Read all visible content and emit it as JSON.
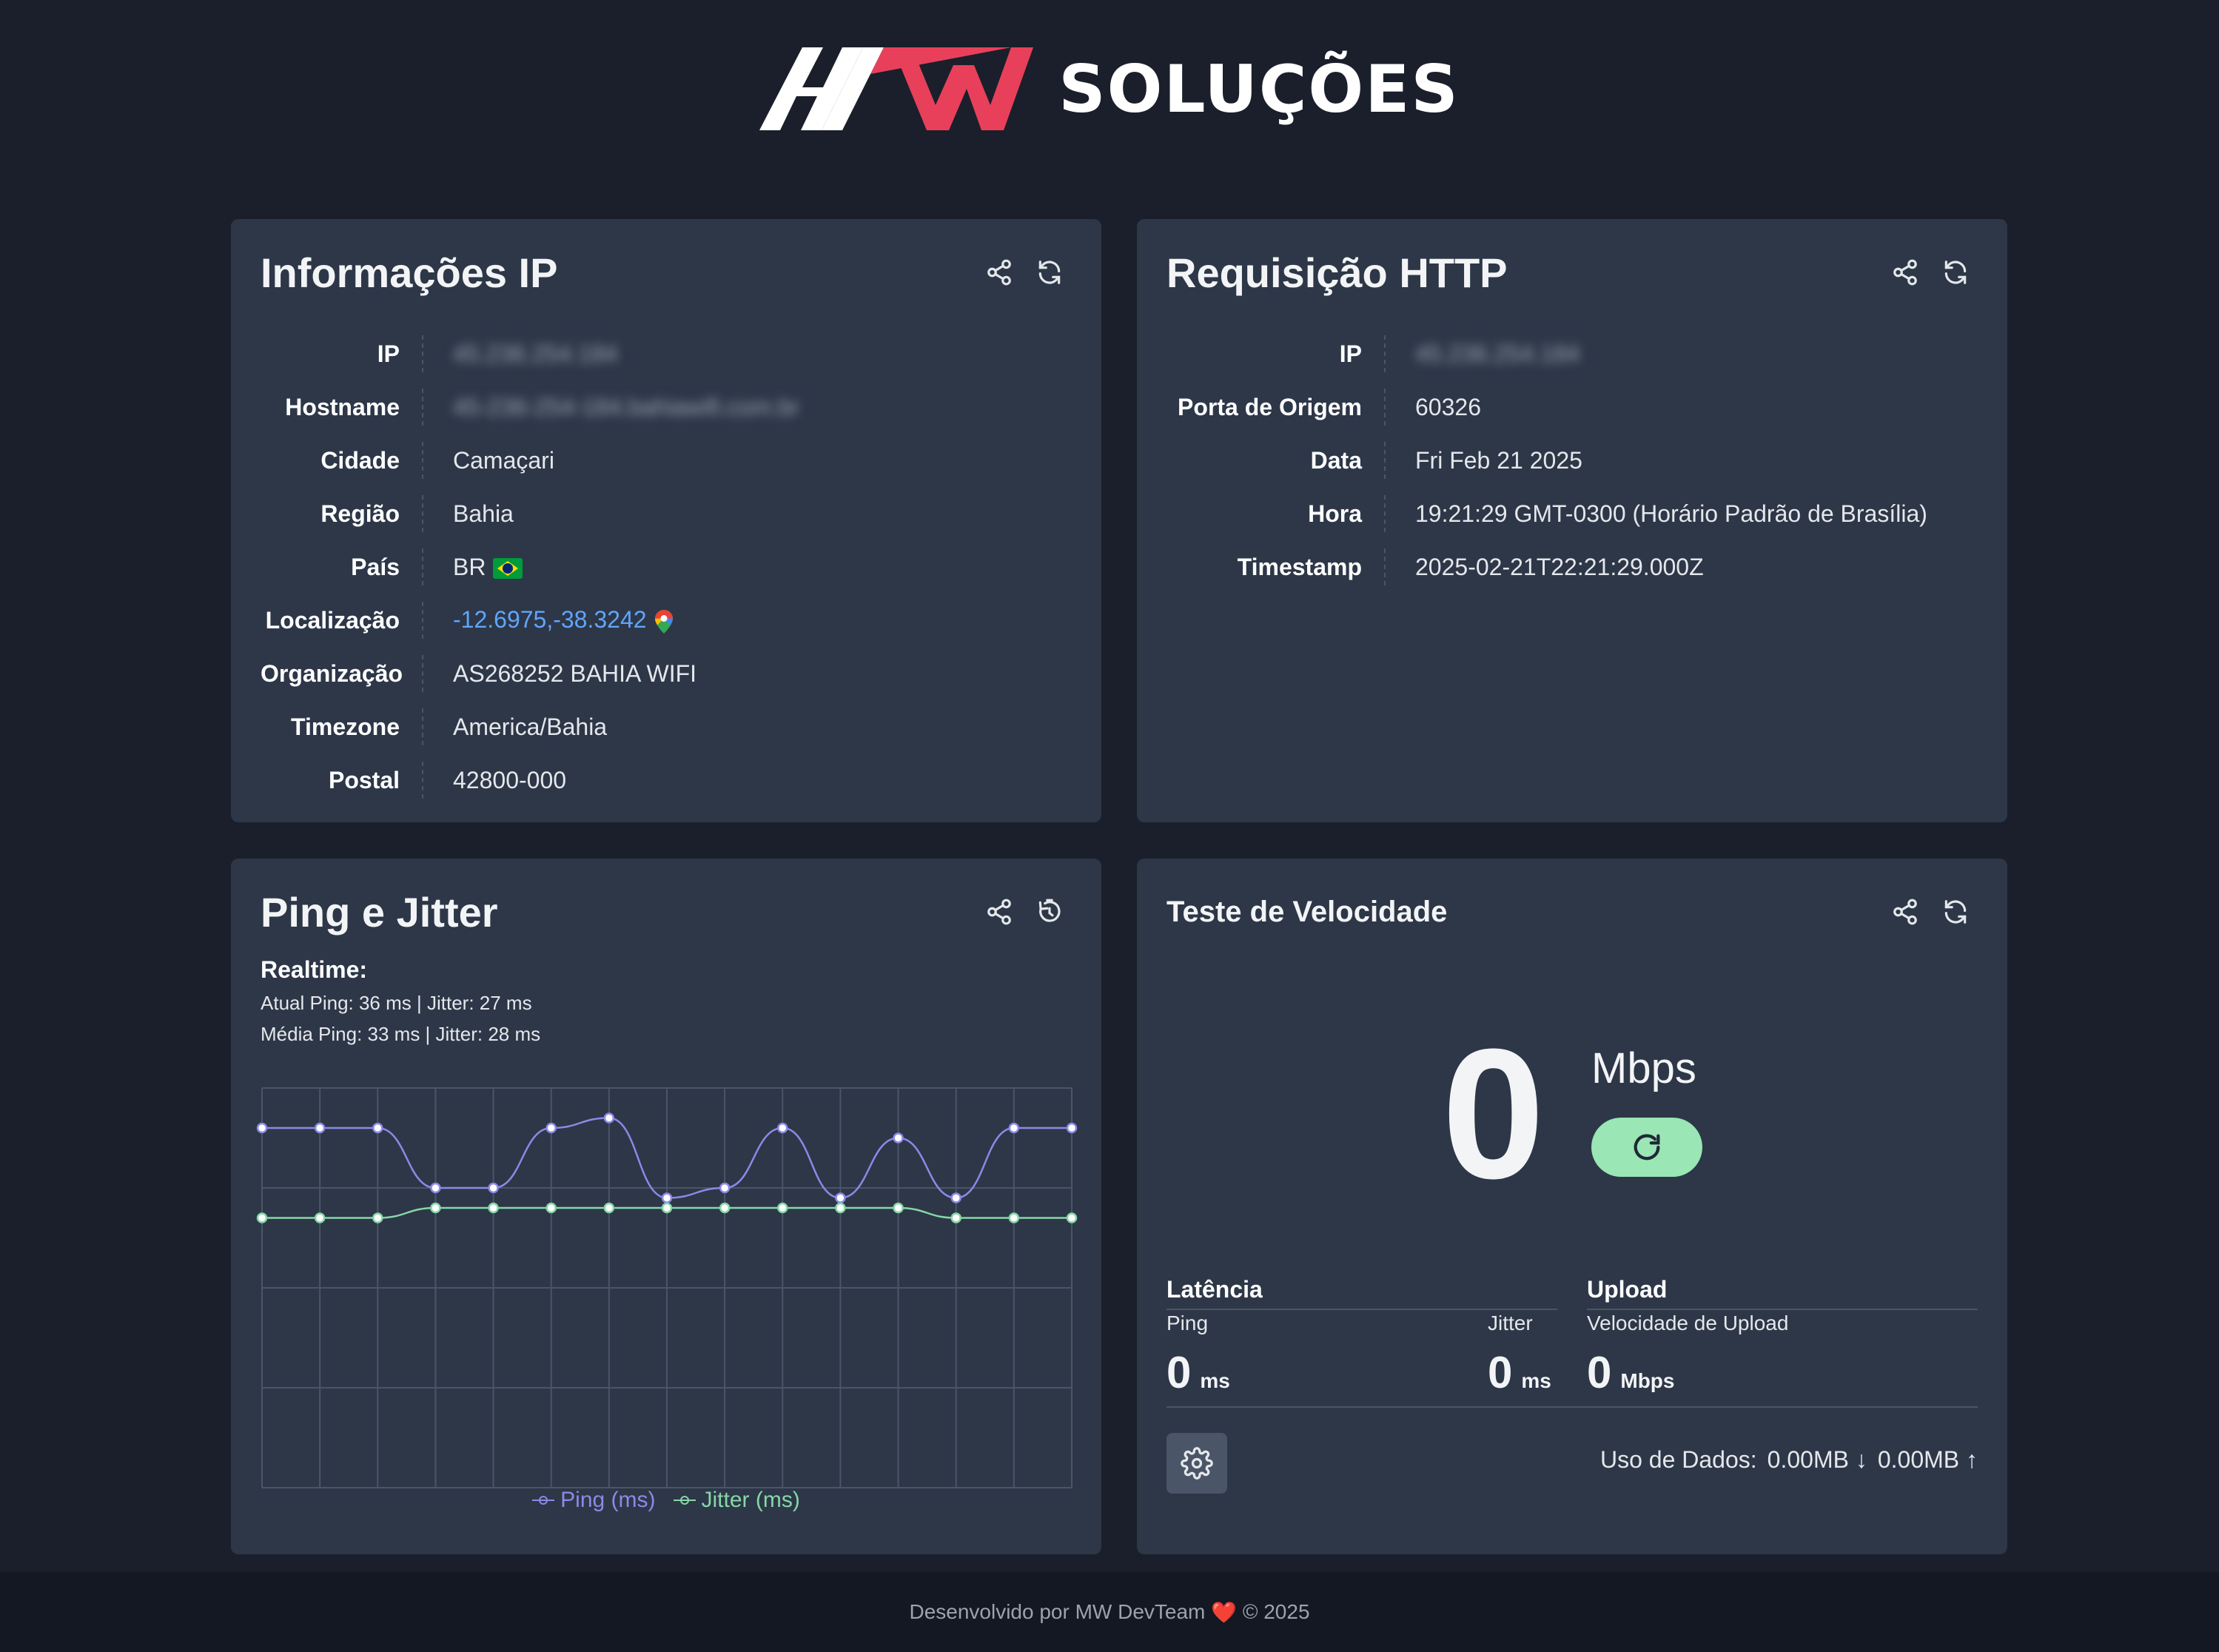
{
  "brand": {
    "name": "SOLUÇÕES",
    "colors": {
      "white": "#ffffff",
      "red": "#e8405a"
    }
  },
  "ip_card": {
    "title": "Informações IP",
    "rows": [
      {
        "label": "IP",
        "value": "45.236.254.184"
      },
      {
        "label": "Hostname",
        "value": "45-236-254-184.bahiawifi.com.br"
      },
      {
        "label": "Cidade",
        "value": "Camaçari"
      },
      {
        "label": "Região",
        "value": "Bahia"
      },
      {
        "label": "País",
        "value": "BR"
      },
      {
        "label": "Localização",
        "value": "-12.6975,-38.3242"
      },
      {
        "label": "Organização",
        "value": "AS268252 BAHIA WIFI"
      },
      {
        "label": "Timezone",
        "value": "America/Bahia"
      },
      {
        "label": "Postal",
        "value": "42800-000"
      }
    ]
  },
  "http_card": {
    "title": "Requisição HTTP",
    "rows": [
      {
        "label": "IP",
        "value": "45.236.254.184"
      },
      {
        "label": "Porta de Origem",
        "value": "60326"
      },
      {
        "label": "Data",
        "value": "Fri Feb 21 2025"
      },
      {
        "label": "Hora",
        "value": "19:21:29 GMT-0300 (Horário Padrão de Brasília)"
      },
      {
        "label": "Timestamp",
        "value": "2025-02-21T22:21:29.000Z"
      }
    ]
  },
  "ping_card": {
    "title": "Ping e Jitter",
    "realtime_label": "Realtime:",
    "current_line": "Atual Ping: 36 ms | Jitter: 27 ms",
    "average_line": "Média Ping: 33 ms | Jitter: 28 ms",
    "legend_ping": "Ping (ms)",
    "legend_jitter": "Jitter (ms)"
  },
  "chart_data": {
    "type": "line",
    "x": [
      1,
      2,
      3,
      4,
      5,
      6,
      7,
      8,
      9,
      10,
      11,
      12,
      13,
      14,
      15
    ],
    "ylim": [
      0,
      40
    ],
    "grid": true,
    "legend_placement": "bottom-center",
    "series": [
      {
        "name": "Ping (ms)",
        "color": "#8b89e6",
        "values": [
          36,
          36,
          36,
          30,
          30,
          36,
          37,
          29,
          30,
          36,
          29,
          35,
          29,
          36,
          36
        ]
      },
      {
        "name": "Jitter (ms)",
        "color": "#86d7a6",
        "values": [
          27,
          27,
          27,
          28,
          28,
          28,
          28,
          28,
          28,
          28,
          28,
          28,
          27,
          27,
          27
        ]
      }
    ]
  },
  "speed_card": {
    "title": "Teste de Velocidade",
    "value": "0",
    "unit": "Mbps",
    "latency_heading": "Latência",
    "upload_heading": "Upload",
    "ping_label": "Ping",
    "jitter_label": "Jitter",
    "upload_label": "Velocidade de Upload",
    "ping_value": "0",
    "jitter_value": "0",
    "upload_value": "0",
    "ms_unit": "ms",
    "mbps_unit": "Mbps",
    "usage_label": "Uso de Dados:",
    "download_usage": "0.00MB ↓",
    "upload_usage": "0.00MB ↑"
  },
  "footer": {
    "text_before": "Desenvolvido por MW DevTeam",
    "heart": "❤️",
    "text_after": "© 2025"
  },
  "icons": [
    "share-icon",
    "refresh-icon",
    "timer-icon",
    "gear-icon",
    "map-pin-icon",
    "brazil-flag-icon"
  ]
}
